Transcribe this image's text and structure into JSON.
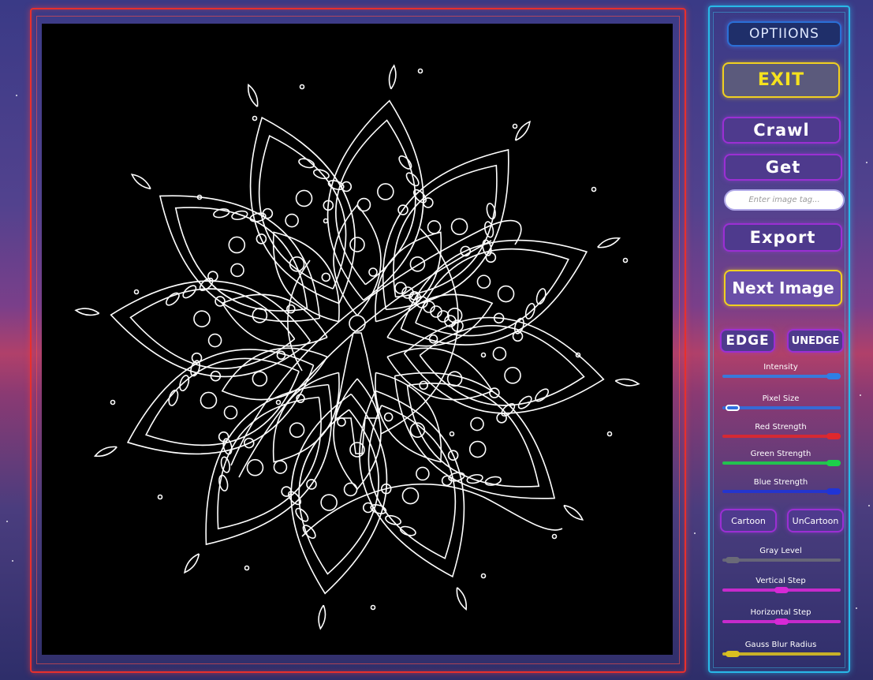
{
  "panel": {
    "options_label": "OPTIIONS",
    "exit_label": "EXIT",
    "crawl_label": "Crawl",
    "get_label": "Get",
    "tag_input": {
      "placeholder": "Enter image tag...",
      "value": ""
    },
    "export_label": "Export",
    "next_image_label": "Next Image",
    "edge_label": "EDGE",
    "unedge_label": "UNEDGE",
    "cartoon_label": "Cartoon",
    "uncartoon_label": "UnCartoon"
  },
  "sliders": [
    {
      "label": "Intensity",
      "value": 1.0,
      "color": "#2f7fe6"
    },
    {
      "label": "Pixel Size",
      "value": 0.03,
      "color": "#2f6fe0"
    },
    {
      "label": "Red Strength",
      "value": 1.0,
      "color": "#e0282c"
    },
    {
      "label": "Green Strength",
      "value": 1.0,
      "color": "#1ccf4a"
    },
    {
      "label": "Blue Strength",
      "value": 1.0,
      "color": "#2034d6"
    },
    {
      "label": "Gray Level",
      "value": 0.03,
      "color": "#6a6a78"
    },
    {
      "label": "Vertical Step",
      "value": 0.5,
      "color": "#d629d6"
    },
    {
      "label": "Horizontal Step",
      "value": 0.5,
      "color": "#d629d6"
    },
    {
      "label": "Gauss Blur Radius",
      "value": 0.03,
      "color": "#d9c020"
    }
  ],
  "canvas": {
    "background": "#000000",
    "line_color": "#ffffff"
  },
  "colors": {
    "frame": "#e8302c",
    "panel": "#29b9e8",
    "button": "#9b2fd3",
    "exit": "#f0d020"
  }
}
